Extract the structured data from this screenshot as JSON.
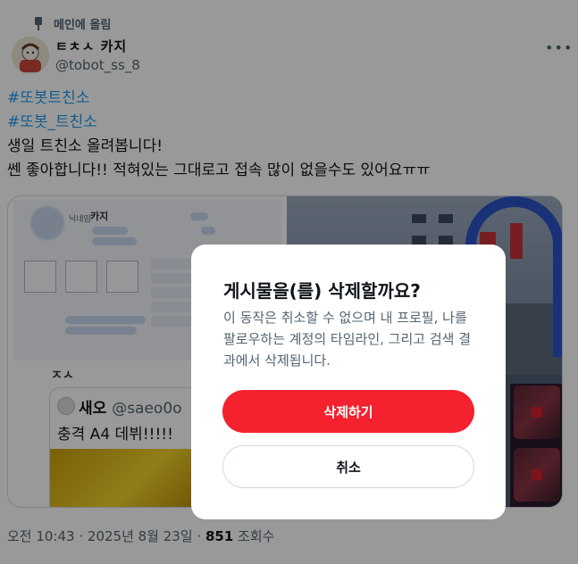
{
  "tweet": {
    "pinned_label": "메인에 올림",
    "author_name": "ㅌㅊㅅ 카지",
    "author_handle": "@tobot_ss_8",
    "more_icon": "more-horizontal-icon",
    "text_lines": [
      "#또봇트친소",
      "#또봇_트친소",
      "생일 트친소 올려봅니다!",
      "쎈 좋아합니다!!  적혀있는 그대로고  접속 많이 없을수도 있어요ㅠㅠ"
    ],
    "timestamp": "오전 10:43 · 2025년 8월 23일 · ",
    "views_count": "851",
    "views_label": " 조회수"
  },
  "media": {
    "card_name_label": "닉네임",
    "card_name": "카지",
    "quote_tag": "ㅈㅅ",
    "quote_author": "새오",
    "quote_handle": "@saeo0o",
    "quote_body": "충격 A4 데뷔!!!!!"
  },
  "dialog": {
    "title": "게시물을(를) 삭제할까요?",
    "message": "이 동작은 취소할 수 없으며 내 프로필, 나를 팔로우하는 계정의 타임라인, 그리고 검색 결과에서 삭제됩니다.",
    "delete_label": "삭제하기",
    "cancel_label": "취소",
    "delete_color": "#f4212e"
  }
}
